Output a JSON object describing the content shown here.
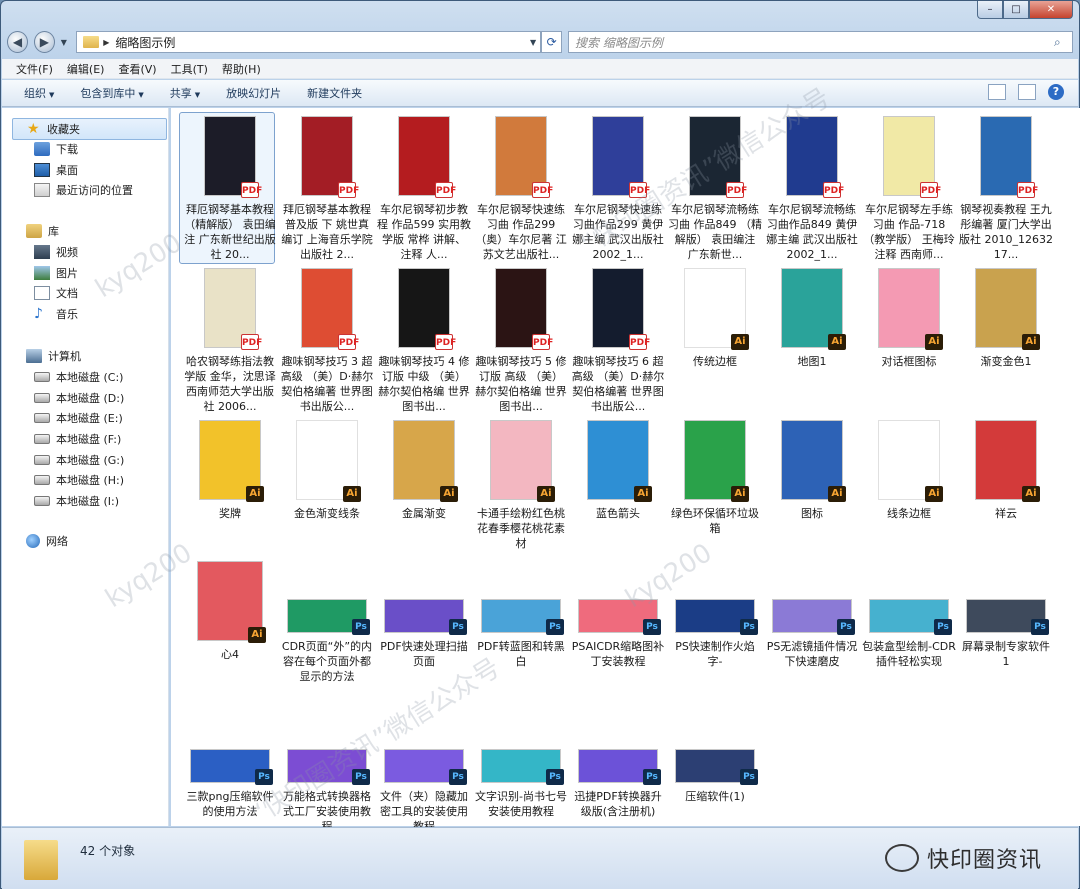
{
  "window": {
    "controls": {
      "minimize": "–",
      "maximize": "□",
      "close": "✕"
    }
  },
  "address_bar": {
    "breadcrumb": "缩略图示例",
    "search_placeholder": "搜索 缩略图示例"
  },
  "menu": [
    "文件(F)",
    "编辑(E)",
    "查看(V)",
    "工具(T)",
    "帮助(H)"
  ],
  "toolbar": {
    "organize": "组织",
    "include": "包含到库中",
    "share": "共享",
    "slideshow": "放映幻灯片",
    "new_folder": "新建文件夹"
  },
  "sidebar": {
    "favorites": "收藏夹",
    "downloads": "下载",
    "desktop": "桌面",
    "recent": "最近访问的位置",
    "libraries": "库",
    "videos": "视频",
    "pictures": "图片",
    "documents": "文档",
    "music": "音乐",
    "computer": "计算机",
    "drives": [
      "本地磁盘 (C:)",
      "本地磁盘 (D:)",
      "本地磁盘 (E:)",
      "本地磁盘 (F:)",
      "本地磁盘 (G:)",
      "本地磁盘 (H:)",
      "本地磁盘 (I:)"
    ],
    "network": "网络"
  },
  "files": [
    {
      "label": "拜厄钢琴基本教程 （精解版） 袁田编注 广东新世纪出版社 20...",
      "type": "pdf",
      "color": "#1c1c28"
    },
    {
      "label": "拜厄钢琴基本教程 普及版 下 姚世真编订 上海音乐学院出版社 2...",
      "type": "pdf",
      "color": "#a31d25"
    },
    {
      "label": "车尔尼钢琴初步教程 作品599 实用教学版 常桦 讲解、注释 人...",
      "type": "pdf",
      "color": "#b41c1f"
    },
    {
      "label": "车尔尼钢琴快速练习曲 作品299 （奥）车尔尼著 江苏文艺出版社...",
      "type": "pdf",
      "color": "#d17a3c"
    },
    {
      "label": "车尔尼钢琴快速练习曲作品299 黄伊娜主编 武汉出版社 2002_1...",
      "type": "pdf",
      "color": "#2f3f9a"
    },
    {
      "label": "车尔尼钢琴流畅练习曲 作品849 （精解版） 袁田编注 广东新世...",
      "type": "pdf",
      "color": "#1b2633"
    },
    {
      "label": "车尔尼钢琴流畅练习曲作品849 黄伊娜主编 武汉出版社 2002_1...",
      "type": "pdf",
      "color": "#203b8f"
    },
    {
      "label": "车尔尼钢琴左手练习曲 作品-718 （教学版） 王梅玲注释 西南师...",
      "type": "pdf",
      "color": "#f1e9a6"
    },
    {
      "label": "钢琴视奏教程 王九彤编著 厦门大学出版社 2010_1263217...",
      "type": "pdf",
      "color": "#2a6ab2"
    },
    {
      "label": "哈农钢琴练指法教学版 金华，沈思译 西南师范大学出版社 2006...",
      "type": "pdf",
      "color": "#e9e2c7"
    },
    {
      "label": "趣味钢琴技巧 3 超高级 （美）D·赫尔契伯格编著 世界图书出版公...",
      "type": "pdf",
      "color": "#de4d33"
    },
    {
      "label": "趣味钢琴技巧 4 修订版 中级 （美）赫尔契伯格编 世界图书出...",
      "type": "pdf",
      "color": "#161616"
    },
    {
      "label": "趣味钢琴技巧 5 修订版 高级 （美）赫尔契伯格编 世界图书出...",
      "type": "pdf",
      "color": "#2b1414"
    },
    {
      "label": "趣味钢琴技巧 6 超高级 （美）D·赫尔契伯格编著 世界图书出版公...",
      "type": "pdf",
      "color": "#141c2e"
    },
    {
      "label": "传统边框",
      "type": "ai",
      "color": "#ffffff"
    },
    {
      "label": "地图1",
      "type": "ai",
      "color": "#2aa39a"
    },
    {
      "label": "对话框图标",
      "type": "ai",
      "color": "#f49ab3"
    },
    {
      "label": "渐变金色1",
      "type": "ai",
      "color": "#c9a24e"
    },
    {
      "label": "奖牌",
      "type": "ai",
      "color": "#f2c22a"
    },
    {
      "label": "金色渐变线条",
      "type": "ai",
      "color": "#ffffff"
    },
    {
      "label": "金属渐变",
      "type": "ai",
      "color": "#d7a64a"
    },
    {
      "label": "卡通手绘粉红色桃花春季樱花桃花素材",
      "type": "ai",
      "color": "#f3b7c1"
    },
    {
      "label": "蓝色箭头",
      "type": "ai",
      "color": "#2e8fd4"
    },
    {
      "label": "绿色环保循环垃圾箱",
      "type": "ai",
      "color": "#2aa24a"
    },
    {
      "label": "图标",
      "type": "ai",
      "color": "#2d62b6"
    },
    {
      "label": "线条边框",
      "type": "ai",
      "color": "#ffffff"
    },
    {
      "label": "祥云",
      "type": "ai",
      "color": "#d33a3a"
    },
    {
      "label": "心4",
      "type": "ai",
      "color": "#e3595f"
    },
    {
      "label": "CDR页面“外”的内容在每个页面外都显示的方法",
      "type": "ps",
      "color": "#1f9a64"
    },
    {
      "label": "PDF快速处理扫描页面",
      "type": "ps",
      "color": "#6a4fc8"
    },
    {
      "label": "PDF转蓝图和转黑白",
      "type": "ps",
      "color": "#4aa3d8"
    },
    {
      "label": "PSAICDR缩略图补丁安装教程",
      "type": "ps",
      "color": "#ef6b7d"
    },
    {
      "label": "PS快速制作火焰字-",
      "type": "ps",
      "color": "#1b3d86"
    },
    {
      "label": "PS无滤镜插件情况下快速磨皮",
      "type": "ps",
      "color": "#8b7ad6"
    },
    {
      "label": "包装盒型绘制-CDR插件轻松实现",
      "type": "ps",
      "color": "#46b1cf"
    },
    {
      "label": "屏幕录制专家软件1",
      "type": "ps",
      "color": "#3e4a5c"
    },
    {
      "label": "三款png压缩软件的使用方法",
      "type": "ps",
      "color": "#2b5fc4"
    },
    {
      "label": "万能格式转换器格式工厂安装使用教程",
      "type": "ps",
      "color": "#7c4dd3"
    },
    {
      "label": "文件（夹）隐藏加密工具的安装使用教程",
      "type": "ps",
      "color": "#7b5be0"
    },
    {
      "label": "文字识别-尚书七号安装使用教程",
      "type": "ps",
      "color": "#34b6c7"
    },
    {
      "label": "迅捷PDF转换器升级版(含注册机)",
      "type": "ps",
      "color": "#6c52d8"
    },
    {
      "label": "压缩软件(1)",
      "type": "ps",
      "color": "#2c3f73"
    }
  ],
  "badges": {
    "pdf": "PDF",
    "ai": "Ai",
    "ps": "Ps"
  },
  "status": {
    "count": "42 个对象",
    "brand": "快印圈资讯"
  },
  "watermarks": [
    "kyq200",
    "“快印圈资讯”微信公众号"
  ]
}
